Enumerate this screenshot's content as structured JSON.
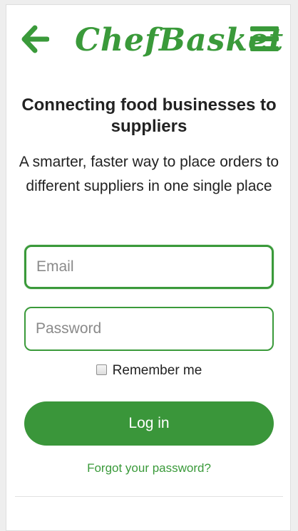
{
  "header": {
    "logo_text": "ChefBasket",
    "back_icon": "arrow-left-icon",
    "menu_icon": "hamburger-menu-icon"
  },
  "hero": {
    "title": "Connecting food businesses to suppliers",
    "subtitle": "A smarter, faster way to place orders to different suppliers in one single place"
  },
  "form": {
    "email": {
      "value": "",
      "placeholder": "Email"
    },
    "password": {
      "value": "",
      "placeholder": "Password"
    },
    "remember_label": "Remember me",
    "remember_checked": false,
    "login_label": "Log in",
    "forgot_label": "Forgot your password?"
  },
  "colors": {
    "brand_green": "#3a9a3a",
    "button_green": "#3a963a",
    "text": "#222222"
  }
}
